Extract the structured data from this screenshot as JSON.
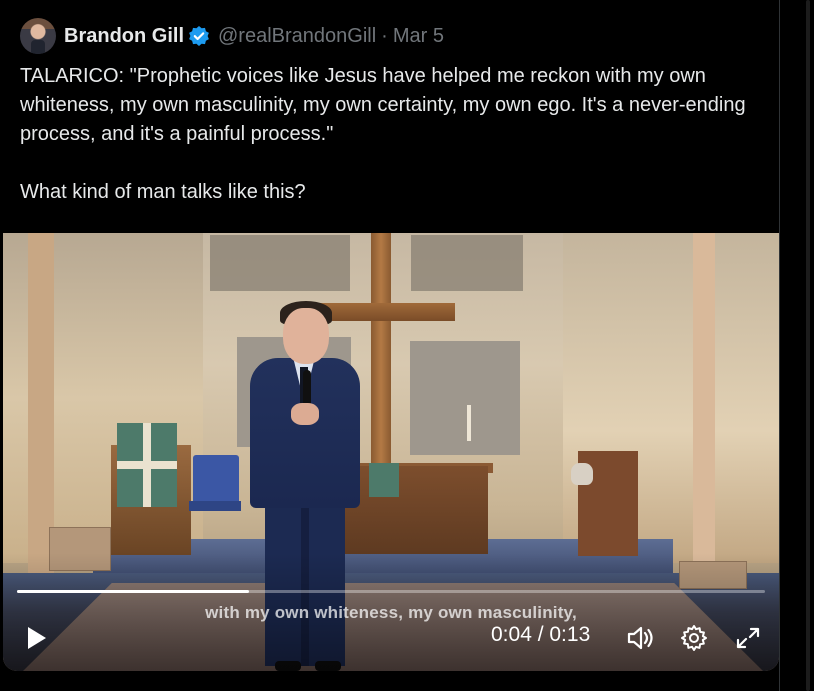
{
  "tweet": {
    "author_name": "Brandon Gill",
    "handle": "@realBrandonGill",
    "separator": "·",
    "date": "Mar 5",
    "text": "TALARICO: \"Prophetic voices like Jesus have helped me reckon with my own whiteness, my own masculinity, my own certainty, my own ego. It's a never-ending process, and it's a painful process.\"\n\nWhat kind of man talks like this?"
  },
  "video": {
    "caption": "with my own whiteness, my own masculinity,",
    "time_display": "0:04 / 0:13",
    "progress_fraction": 0.31,
    "controls": {
      "play_icon": "play-icon",
      "volume_icon": "volume-icon",
      "settings_icon": "gear-icon",
      "fullscreen_icon": "expand-icon"
    }
  },
  "colors": {
    "background": "#000000",
    "text_primary": "#e7e9ea",
    "text_secondary": "#71767b",
    "verified_badge": "#1d9bf0"
  }
}
